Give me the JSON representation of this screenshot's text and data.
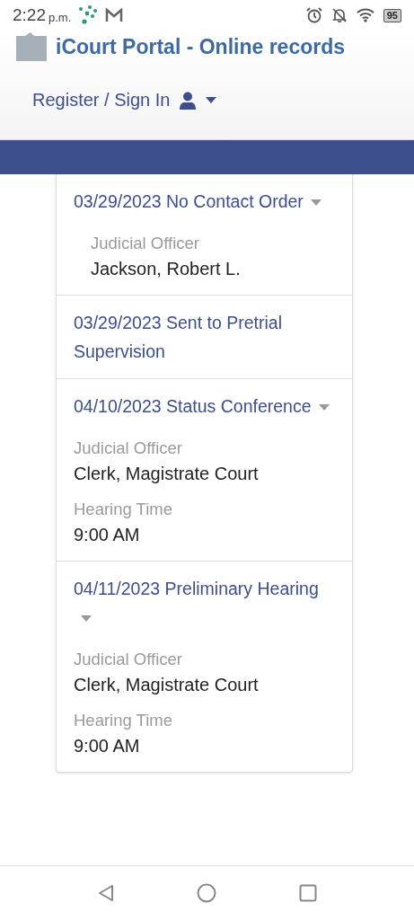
{
  "status_bar": {
    "time": "2:22",
    "period": "p.m.",
    "battery": "95"
  },
  "header": {
    "title": "iCourt Portal - Online records",
    "sign_in": "Register / Sign In"
  },
  "events": [
    {
      "title": "03/29/2023 No Contact Order",
      "expandable": true,
      "indented": true,
      "fields": [
        {
          "label": "Judicial Officer",
          "value": "Jackson, Robert L."
        }
      ]
    },
    {
      "title": "03/29/2023 Sent to Pretrial Supervision",
      "expandable": false
    },
    {
      "title": "04/10/2023 Status Conference",
      "expandable": true,
      "indented": false,
      "fields": [
        {
          "label": "Judicial Officer",
          "value": "Clerk, Magistrate Court"
        },
        {
          "label": "Hearing Time",
          "value": "9:00 AM"
        }
      ]
    },
    {
      "title": "04/11/2023 Preliminary Hearing",
      "expandable": true,
      "indented": false,
      "fields": [
        {
          "label": "Judicial Officer",
          "value": "Clerk, Magistrate Court"
        },
        {
          "label": "Hearing Time",
          "value": "9:00 AM"
        }
      ]
    }
  ]
}
